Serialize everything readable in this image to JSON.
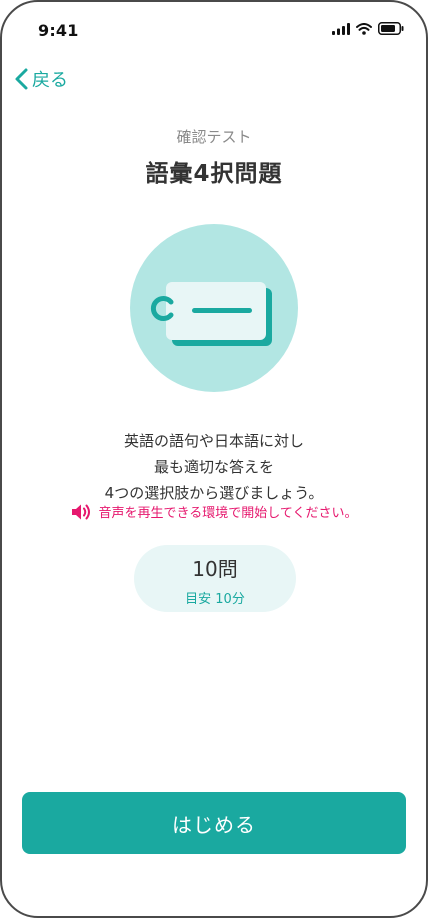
{
  "status_bar": {
    "time": "9:41"
  },
  "nav": {
    "back_label": "戻る"
  },
  "header": {
    "subtitle": "確認テスト",
    "title": "語彙4択問題"
  },
  "description": {
    "lines": [
      "英語の語句や日本語に対し",
      "最も適切な答えを",
      "4つの選択肢から選びましょう。"
    ],
    "sound_note": "音声を再生できる環境で開始してください。"
  },
  "info": {
    "count": "10問",
    "estimate": "目安 10分"
  },
  "actions": {
    "start_label": "はじめる"
  },
  "colors": {
    "accent": "#1aa9a0",
    "warning": "#e6186e",
    "illustration_bg": "#b2e6e3",
    "pill_bg": "#e8f6f6"
  },
  "icons": [
    "signal-icon",
    "wifi-icon",
    "battery-icon",
    "chevron-left-icon",
    "card-tag-icon",
    "speaker-icon"
  ]
}
